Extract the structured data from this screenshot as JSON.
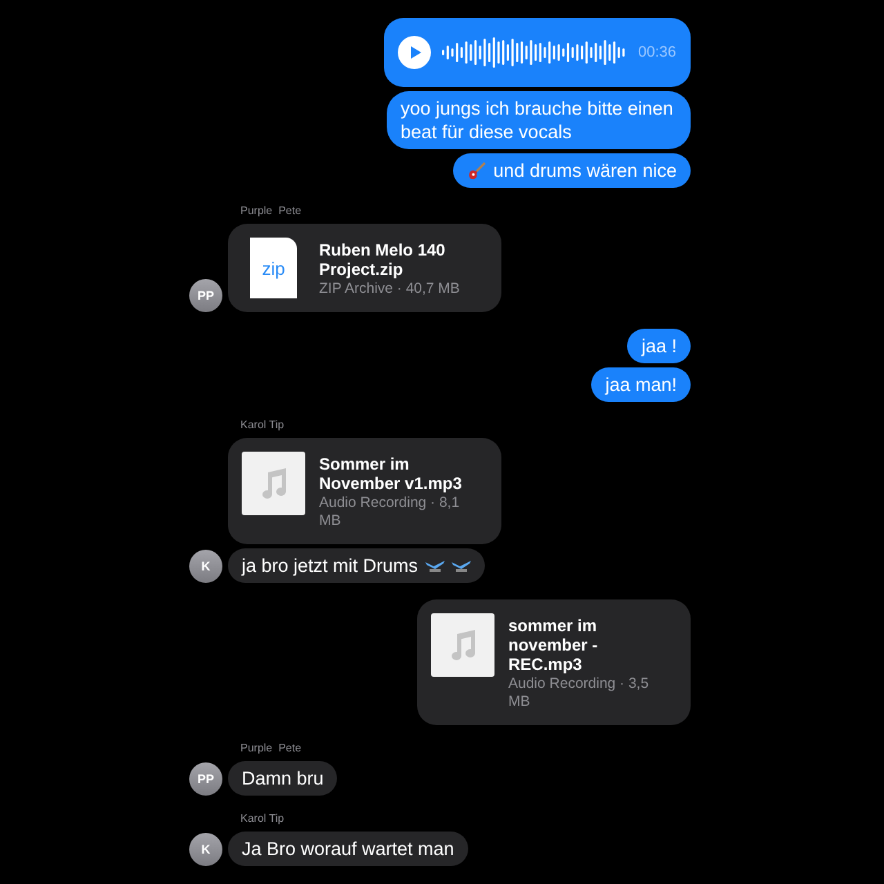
{
  "groups": [
    {
      "kind": "sent",
      "messages": [
        {
          "kind": "voice",
          "duration": "00:36"
        },
        {
          "kind": "text",
          "text": "yoo jungs ich brauche bitte einen beat für diese vocals"
        },
        {
          "kind": "text",
          "text": "und drums wären nice",
          "lead_icons": [
            {
              "kind": "guitar"
            }
          ]
        }
      ]
    },
    {
      "kind": "received",
      "sender": "Purple  Pete",
      "avatar": "PP",
      "messages": [
        {
          "kind": "zip_file",
          "badge": "zip",
          "name": "Ruben Melo 140 Project.zip",
          "meta": "ZIP Archive · 40,7 MB"
        }
      ]
    },
    {
      "kind": "sent",
      "messages": [
        {
          "kind": "text",
          "text": "jaa !"
        },
        {
          "kind": "text",
          "text": "jaa man!"
        }
      ]
    },
    {
      "kind": "received",
      "sender": "Karol Tip",
      "avatar": "K",
      "messages": [
        {
          "kind": "audio_file",
          "name": "Sommer im November v1.mp3",
          "meta": "Audio Recording · 8,1 MB"
        },
        {
          "kind": "text",
          "text": "ja bro jetzt mit Drums",
          "trail_icons": [
            {
              "kind": "stick"
            },
            {
              "kind": "stick"
            }
          ]
        }
      ]
    },
    {
      "kind": "sent",
      "messages": [
        {
          "kind": "audio_file",
          "name": "sommer im november - REC.mp3",
          "meta": "Audio Recording · 3,5 MB"
        }
      ]
    },
    {
      "kind": "received",
      "sender": "Purple  Pete",
      "avatar": "PP",
      "messages": [
        {
          "kind": "text",
          "text": "Damn bru"
        }
      ]
    },
    {
      "kind": "received",
      "sender": "Karol Tip",
      "avatar": "K",
      "messages": [
        {
          "kind": "text",
          "text": "Ja Bro worauf wartet man"
        }
      ]
    }
  ]
}
